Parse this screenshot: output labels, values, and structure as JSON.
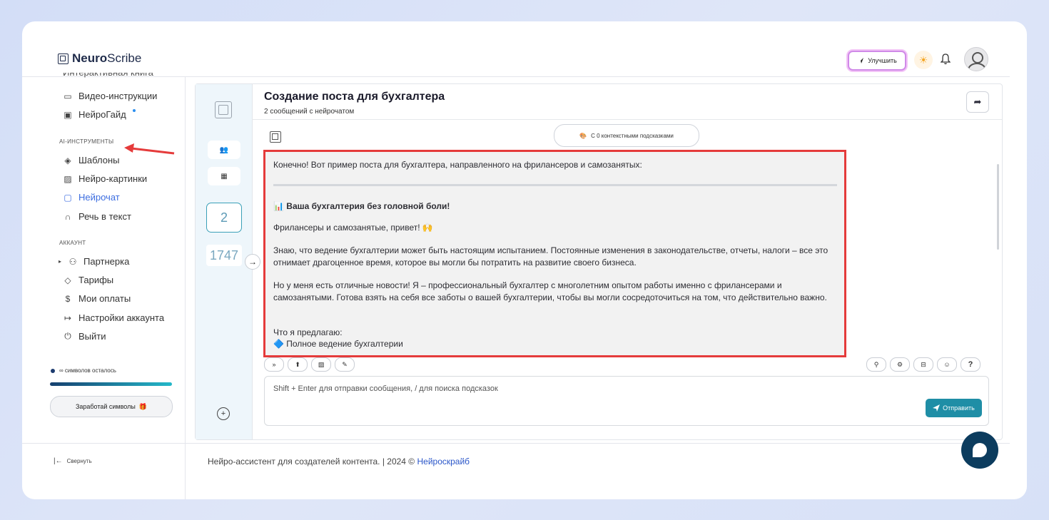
{
  "brand": {
    "name_bold": "Neuro",
    "name_rest": "Scribe"
  },
  "header": {
    "upgrade_label": "Улучшить",
    "sun_icon": "☀",
    "bell_icon": "🔔"
  },
  "sidebar": {
    "cut_item": "Интерактивная книга",
    "items_top": [
      {
        "icon": "▭",
        "label": "Видео-инструкции"
      },
      {
        "icon": "▣",
        "label": "НейроГайд"
      }
    ],
    "ai_heading": "AI-ИНСТРУМЕНТЫ",
    "ai_items": [
      {
        "icon": "◈",
        "label": "Шаблоны"
      },
      {
        "icon": "▨",
        "label": "Нейро-картинки"
      },
      {
        "icon": "▢",
        "label": "Нейрочат"
      },
      {
        "icon": "∩",
        "label": "Речь в текст"
      }
    ],
    "account_heading": "АККАУНТ",
    "account_items": [
      {
        "icon": "⚇",
        "label": "Партнерка"
      },
      {
        "icon": "◇",
        "label": "Тарифы"
      },
      {
        "icon": "$",
        "label": "Мои оплаты"
      },
      {
        "icon": "↦",
        "label": "Настройки аккаунта"
      },
      {
        "icon": "⏻",
        "label": "Выйти"
      }
    ],
    "symbols_label": "∞ символов осталось",
    "earn_label": "Заработай символы",
    "earn_icon": "🎁",
    "collapse_label": "Свернуть"
  },
  "chat": {
    "title": "Создание поста для бухгалтера",
    "subtitle": "2 сообщений с нейрочатом",
    "hints_label": "С 0 контекстными подсказками",
    "left_counts": {
      "messages": "2",
      "number": "1747"
    },
    "message": {
      "intro": "Конечно! Вот пример поста для бухгалтера, направленного на фрилансеров и самозанятых:",
      "heading": "📊 Ваша бухгалтерия без головной боли!",
      "greeting": "Фрилансеры и самозанятые, привет! 🙌",
      "p1": "Знаю, что ведение бухгалтерии может быть настоящим испытанием. Постоянные изменения в законодательстве, отчеты, налоги – все это отнимает драгоценное время, которое вы могли бы потратить на развитие своего бизнеса.",
      "p2": "Но у меня есть отличные новости! Я – профессиональный бухгалтер с многолетним опытом работы именно с фрилансерами и самозанятыми. Готова взять на себя все заботы о вашей бухгалтерии, чтобы вы могли сосредоточиться на том, что действительно важно.",
      "offer": "Что я предлагаю:",
      "bullet1": "🔷 Полное ведение бухгалтерии"
    },
    "input_placeholder": "Shift + Enter для отправки сообщения, / для поиска подсказок",
    "send_label": "Отправить"
  },
  "footer": {
    "text": "Нейро-ассистент для создателей контента.  | 2024 © ",
    "link": "Нейроскрайб"
  },
  "colors": {
    "accent": "#1f8ea6",
    "highlight_border": "#e53b3b",
    "active_link": "#3c6de0"
  }
}
